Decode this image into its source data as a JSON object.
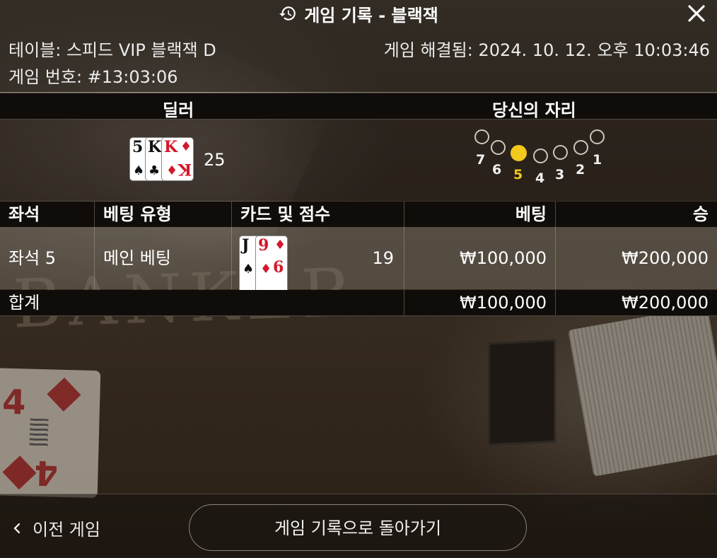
{
  "header": {
    "title": "게임 기록 - 블랙잭"
  },
  "meta": {
    "table_label": "테이블: 스피드 VIP 블랙잭 D",
    "game_number": "게임 번호: #13:03:06",
    "resolved": "게임 해결됨: 2024. 10. 12. 오후 10:03:46"
  },
  "sections": {
    "dealer": "딜러",
    "your_seat": "당신의 자리"
  },
  "dealer": {
    "cards": [
      {
        "rank": "5",
        "suit": "♠",
        "color": "black"
      },
      {
        "rank": "K",
        "suit": "♣",
        "color": "black"
      },
      {
        "rank": "K",
        "suit": "♦",
        "color": "red"
      }
    ],
    "score": "25"
  },
  "seats": {
    "numbers": [
      "7",
      "6",
      "5",
      "4",
      "3",
      "2",
      "1"
    ],
    "active": "5"
  },
  "table": {
    "headers": [
      "좌석",
      "베팅 유형",
      "카드 및 점수",
      "베팅",
      "승"
    ],
    "row": {
      "seat": "좌석 5",
      "bet_type": "메인 베팅",
      "cards": [
        {
          "rank": "J",
          "suit": "♠",
          "color": "black"
        },
        {
          "rank": "9",
          "suit": "♦",
          "color": "red",
          "bottom": "6"
        }
      ],
      "score": "19",
      "bet": "₩100,000",
      "win": "₩200,000"
    },
    "total": {
      "label": "합계",
      "bet": "₩100,000",
      "win": "₩200,000"
    }
  },
  "footer": {
    "prev_game": "이전 게임",
    "back_button": "게임 기록으로 돌아가기"
  },
  "background": {
    "table_text": "BANKER"
  },
  "colors": {
    "accent_seat": "#f2c91c",
    "card_red": "#d3182b"
  }
}
